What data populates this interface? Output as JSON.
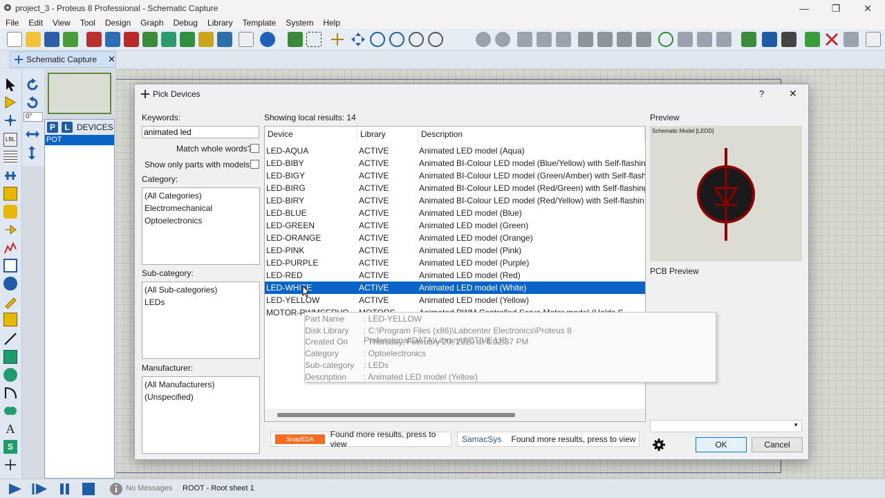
{
  "window": {
    "title": "project_3 - Proteus 8 Professional - Schematic Capture",
    "minimize": "—",
    "restore": "❐",
    "close": "✕"
  },
  "menu": [
    "File",
    "Edit",
    "View",
    "Tool",
    "Design",
    "Graph",
    "Debug",
    "Library",
    "Template",
    "System",
    "Help"
  ],
  "tab": {
    "label": "Schematic Capture",
    "close": "✕"
  },
  "left": {
    "rotation_value": "0°",
    "p_label": "P",
    "l_label": "L",
    "devices_label": "DEVICES",
    "device_item": "POT"
  },
  "status": {
    "messages": "No Messages",
    "sheet": "ROOT - Root sheet 1"
  },
  "dialog": {
    "title": "Pick Devices",
    "help": "?",
    "close": "✕",
    "keywords_label": "Keywords:",
    "keywords_value": "animated led",
    "match_whole": "Match whole words?",
    "show_only": "Show only parts with models?",
    "category_label": "Category:",
    "categories": [
      "(All Categories)",
      "Electromechanical",
      "Optoelectronics"
    ],
    "subcategory_label": "Sub-category:",
    "subcategories": [
      "(All Sub-categories)",
      "LEDs"
    ],
    "manufacturer_label": "Manufacturer:",
    "manufacturers": [
      "(All Manufacturers)",
      "(Unspecified)"
    ],
    "results_label": "Showing local results: 14",
    "columns": {
      "device": "Device",
      "library": "Library",
      "description": "Description"
    },
    "rows": [
      [
        "LED-AQUA",
        "ACTIVE",
        "Animated LED model (Aqua)"
      ],
      [
        "LED-BIBY",
        "ACTIVE",
        "Animated BI-Colour LED model (Blue/Yellow) with Self-flashin"
      ],
      [
        "LED-BIGY",
        "ACTIVE",
        "Animated BI-Colour LED model (Green/Amber) with Self-flash"
      ],
      [
        "LED-BIRG",
        "ACTIVE",
        "Animated BI-Colour LED model (Red/Green) with Self-flashing"
      ],
      [
        "LED-BIRY",
        "ACTIVE",
        "Animated BI-Colour LED model (Red/Yellow) with Self-flashin"
      ],
      [
        "LED-BLUE",
        "ACTIVE",
        "Animated LED model (Blue)"
      ],
      [
        "LED-GREEN",
        "ACTIVE",
        "Animated LED model (Green)"
      ],
      [
        "LED-ORANGE",
        "ACTIVE",
        "Animated LED model (Orange)"
      ],
      [
        "LED-PINK",
        "ACTIVE",
        "Animated LED model (Pink)"
      ],
      [
        "LED-PURPLE",
        "ACTIVE",
        "Animated LED model (Purple)"
      ],
      [
        "LED-RED",
        "ACTIVE",
        "Animated LED model (Red)"
      ],
      [
        "LED-WHITE",
        "ACTIVE",
        "Animated LED model (White)"
      ],
      [
        "LED-YELLOW",
        "ACTIVE",
        "Animated LED model (Yellow)"
      ],
      [
        "MOTOR-PWMSERVO",
        "MOTORS",
        "Animated PWM Controlled Servo Motor model (Holds S"
      ]
    ],
    "tooltip": [
      [
        "Part Name",
        ": LED-YELLOW"
      ],
      [
        "Disk Library",
        ": C:\\Program Files (x86)\\Labcenter Electronics\\Proteus 8 Professional\\DATA\\Library\\ACTIVE.LIB"
      ],
      [
        "Created On",
        ": Thursday, February 20, 2020 at 6:02:37 PM"
      ],
      [
        "Category",
        ": Optoelectronics"
      ],
      [
        "Sub-category",
        ": LEDs"
      ],
      [
        "Description",
        ": Animated LED model (Yellow)"
      ]
    ],
    "snapeda": "SnapEDA",
    "snapeda_text": "Found more results, press to view",
    "samacsys": "SamacSys",
    "samacsys_text": "Found more results, press to view",
    "preview_label": "Preview",
    "schematic_model": "Schematic Model [LEDD]",
    "pcb_preview": "PCB Preview",
    "ok": "OK",
    "cancel": "Cancel"
  },
  "colors": {
    "selection": "#0a64c8",
    "accent": "#0078d7",
    "led_red": "#7a0000"
  }
}
